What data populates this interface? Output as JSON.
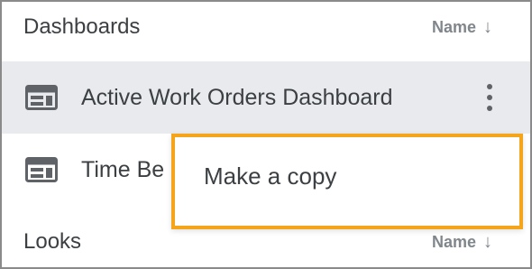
{
  "dashboards_section": {
    "title": "Dashboards",
    "sort_label": "Name",
    "sort_direction": "↓",
    "items": [
      {
        "label": "Active Work Orders Dashboard",
        "icon": "dashboard-icon",
        "selected": true
      },
      {
        "label": "Time Be",
        "icon": "dashboard-icon",
        "selected": false
      }
    ]
  },
  "context_menu": {
    "items": [
      {
        "label": "Make a copy"
      }
    ],
    "highlight_color": "#f5a51c"
  },
  "looks_section": {
    "title": "Looks",
    "sort_label": "Name",
    "sort_direction": "↓"
  },
  "colors": {
    "selected_row": "#e8eaed",
    "text": "#3c4043",
    "muted": "#80868b"
  }
}
